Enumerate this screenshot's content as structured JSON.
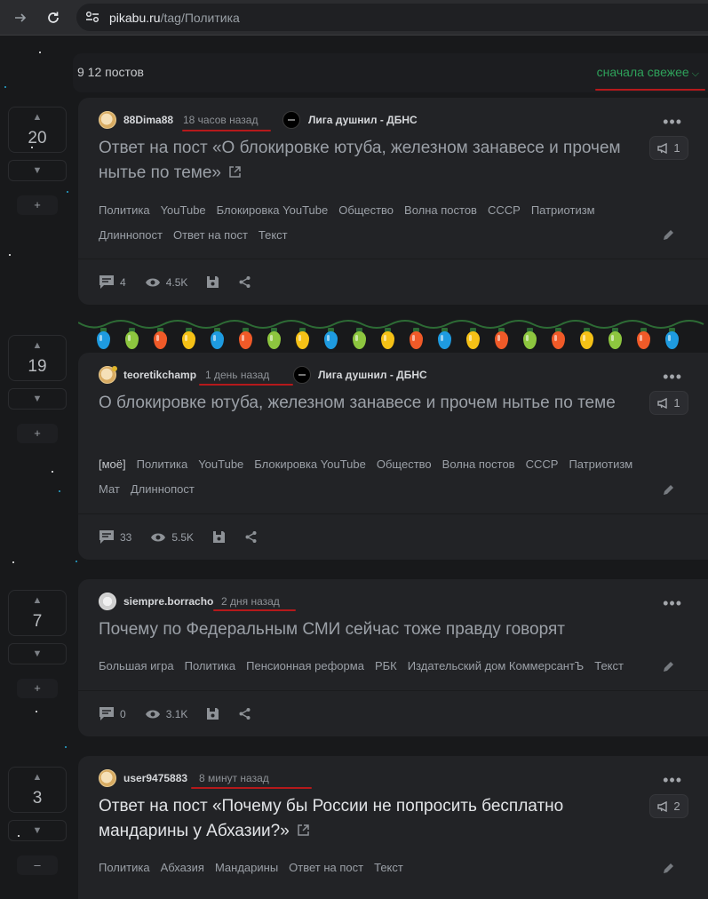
{
  "browser": {
    "url_host": "pikabu.ru",
    "url_path": "/tag/Политика"
  },
  "header": {
    "post_count": "9 12 постов",
    "sort_label": "сначала свежее"
  },
  "posts": [
    {
      "votes": "20",
      "vote_extra": "+",
      "author": "88Dima88",
      "time": "18 часов назад",
      "community": "Лига душнил - ДБНС",
      "title": "Ответ на пост «О блокировке ютуба, железном занавесе и прочем нытье по теме»",
      "badge": "1",
      "tags": [
        "Политика",
        "YouTube",
        "Блокировка YouTube",
        "Общество",
        "Волна постов",
        "СССР",
        "Патриотизм",
        "Длиннопост",
        "Ответ на пост",
        "Текст"
      ],
      "comments": "4",
      "views": "4.5K"
    },
    {
      "votes": "19",
      "vote_extra": "+",
      "author": "teoretikchamp",
      "time": "1 день назад",
      "community": "Лига душнил - ДБНС",
      "title": "О блокировке ютуба, железном занавесе и прочем нытье по теме",
      "badge": "1",
      "tags": [
        "[моё]",
        "Политика",
        "YouTube",
        "Блокировка YouTube",
        "Общество",
        "Волна постов",
        "СССР",
        "Патриотизм",
        "Мат",
        "Длиннопост"
      ],
      "comments": "33",
      "views": "5.5K"
    },
    {
      "votes": "7",
      "vote_extra": "+",
      "author": "siempre.borracho",
      "time": "2 дня назад",
      "title": "Почему по Федеральным СМИ сейчас тоже правду говорят",
      "tags": [
        "Большая игра",
        "Политика",
        "Пенсионная реформа",
        "РБК",
        "Издательский дом КоммерсантЪ",
        "Текст"
      ],
      "comments": "0",
      "views": "3.1K"
    },
    {
      "votes": "3",
      "vote_extra": "–",
      "author": "user9475883",
      "time": "8 минут назад",
      "title": "Ответ на пост «Почему бы России не попросить бесплатно мандарины у Абхазии?»",
      "badge": "2",
      "tags": [
        "Политика",
        "Абхазия",
        "Мандарины",
        "Ответ на пост",
        "Текст"
      ]
    }
  ],
  "colors": {
    "accent": "#2ea15a",
    "annotation": "#b5191b",
    "garland": [
      "#1e9be0",
      "#8dc63f",
      "#f05a28",
      "#f5c116"
    ]
  }
}
